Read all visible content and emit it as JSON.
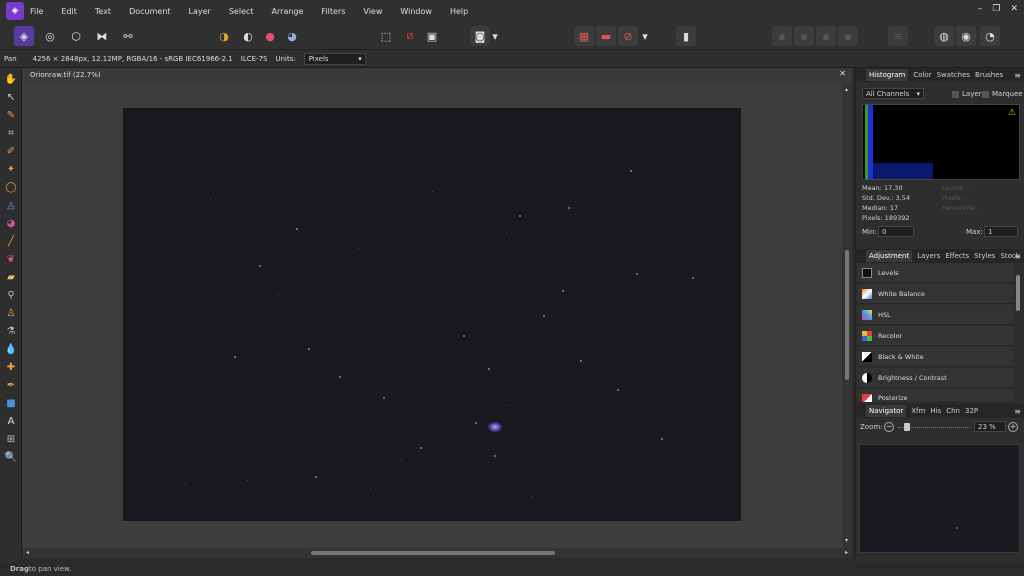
{
  "menu": [
    "File",
    "Edit",
    "Text",
    "Document",
    "Layer",
    "Select",
    "Arrange",
    "Filters",
    "View",
    "Window",
    "Help"
  ],
  "window_controls": [
    "–",
    "❐",
    "✕"
  ],
  "context": {
    "tool": "Pan",
    "info": "4256 × 2848px, 12.12MP, RGBA/16 - sRGB IEC61966-2.1",
    "camera": "ILCE-7S",
    "units_label": "Units:",
    "units_value": "Pixels"
  },
  "document": {
    "tab_title": "Orionraw.tif (22.7%)"
  },
  "status": {
    "bold": "Drag",
    "rest": " to pan view."
  },
  "histogram": {
    "tabs": [
      "Histogram",
      "Color",
      "Swatches",
      "Brushes"
    ],
    "channel": "All Channels",
    "layer_label": "Layer",
    "marquee_label": "Marquee",
    "mean": "Mean: 17.30",
    "std": "Std. Dev.: 3.54",
    "median": "Median: 17",
    "pixels": "Pixels: 189392",
    "levels": "Levels: -",
    "count": "Pixels: -",
    "percentile": "Percentile: -",
    "min_label": "Min:",
    "min_value": "0",
    "max_label": "Max:",
    "max_value": "1"
  },
  "adjustment": {
    "tabs": [
      "Adjustment",
      "Layers",
      "Effects",
      "Styles",
      "Stock"
    ],
    "items": [
      "Levels",
      "White Balance",
      "HSL",
      "Recolor",
      "Black & White",
      "Brightness / Contrast",
      "Posterize"
    ]
  },
  "navigator": {
    "tabs": [
      "Navigator",
      "Xfm",
      "His",
      "Chn",
      "32P"
    ],
    "zoom_label": "Zoom:",
    "zoom_value": "23 %",
    "zoom_level": 0.23
  },
  "colors": {
    "accent": "#7a3cc8",
    "star": "#7f71e6",
    "canvas": "#1a171e"
  }
}
